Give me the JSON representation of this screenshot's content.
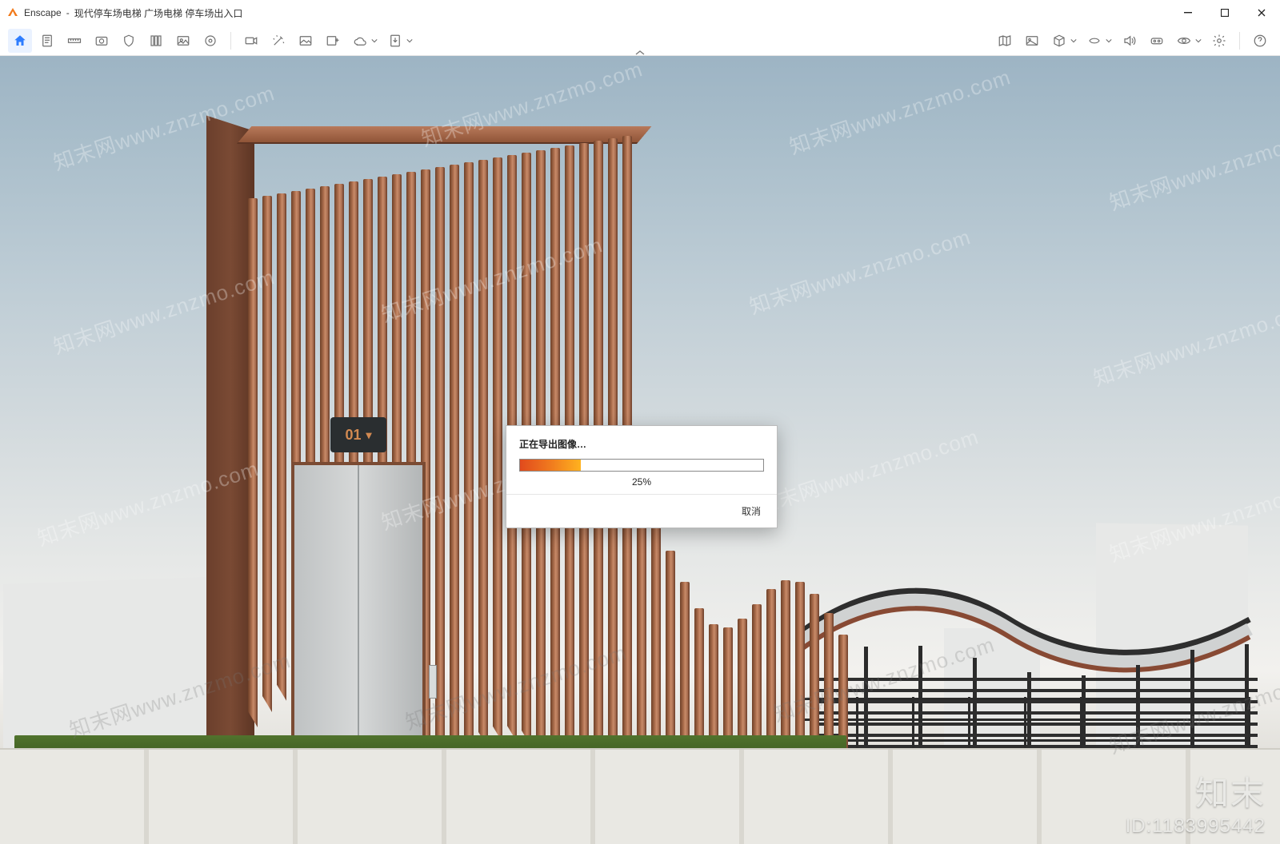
{
  "app": {
    "name": "Enscape",
    "title_separator": " - ",
    "document_title": "现代停车场电梯 广场电梯 停车场出入口"
  },
  "window_controls": {
    "minimize": "minimize",
    "maximize": "maximize",
    "close": "close"
  },
  "toolbar": {
    "left_icons": [
      "home",
      "page",
      "ruler",
      "screenshot",
      "shield",
      "library",
      "image-library",
      "media",
      "video-record",
      "magic-wand",
      "image",
      "image-add",
      "cloud",
      "export"
    ],
    "right_icons": [
      "map",
      "gallery",
      "cube",
      "labels",
      "sound",
      "vr",
      "visibility",
      "settings",
      "help"
    ]
  },
  "dialog": {
    "title": "正在导出图像…",
    "percent_value": 25,
    "percent_label": "25%",
    "cancel_label": "取消"
  },
  "elevator": {
    "floor_indicator": "01",
    "direction": "down"
  },
  "watermark": {
    "repeat_text": "知末网www.znzmo.com",
    "corner_line1": "知末",
    "corner_line2": "ID:1183995442"
  }
}
